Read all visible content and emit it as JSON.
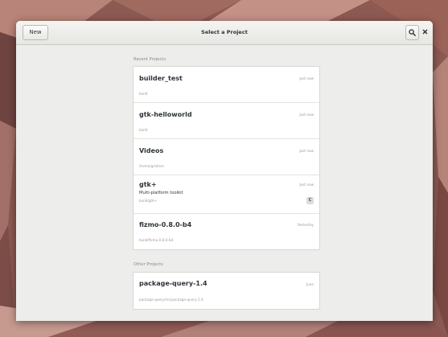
{
  "window": {
    "title": "Select a Project",
    "new_button_label": "New"
  },
  "icons": {
    "search": "search-icon",
    "close": "close-icon"
  },
  "recent": {
    "label": "Recent Projects",
    "items": [
      {
        "name": "builder_test",
        "path": "build",
        "time": "Just now"
      },
      {
        "name": "gtk-helloworld",
        "path": "build",
        "time": "Just now"
      },
      {
        "name": "Videos",
        "path": "/home/grahem",
        "time": "Just now"
      },
      {
        "name": "gtk+",
        "description": "Multi-platform toolkit",
        "path": "build/gtk+",
        "time": "Just now",
        "badge": "C"
      },
      {
        "name": "fizmo-0.8.0-b4",
        "path": "build/fizmo-0.8.0-b4",
        "time": "Yesterday"
      }
    ]
  },
  "other": {
    "label": "Other Projects",
    "items": [
      {
        "name": "package-query-1.4",
        "path": "package-query/src/package-query-1.4",
        "time": "June"
      }
    ]
  },
  "colors": {
    "window_bg": "#ededeb",
    "card_bg": "#ffffff",
    "text": "#2e3436",
    "muted": "#9a9a96"
  }
}
